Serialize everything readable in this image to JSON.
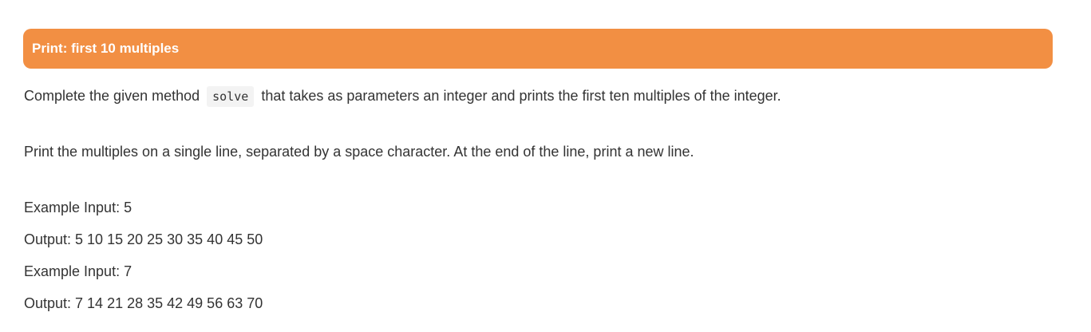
{
  "header": {
    "title": "Print: first 10 multiples"
  },
  "description": {
    "part1": "Complete the given method",
    "code": "solve",
    "part2": "that takes as parameters an integer and prints the first ten multiples of the integer.",
    "line2": "Print the multiples on a single line, separated by a space character. At the end of the line, print a new line."
  },
  "examples": [
    {
      "input": "Example Input: 5",
      "output": "Output: 5 10 15 20 25 30 35 40 45 50"
    },
    {
      "input": "Example Input: 7",
      "output": "Output: 7 14 21 28 35 42 49 56 63 70"
    }
  ],
  "colors": {
    "header_bg": "#f28f43",
    "header_text": "#ffffff",
    "body_text": "#333333",
    "code_bg": "#f3f3f3"
  }
}
